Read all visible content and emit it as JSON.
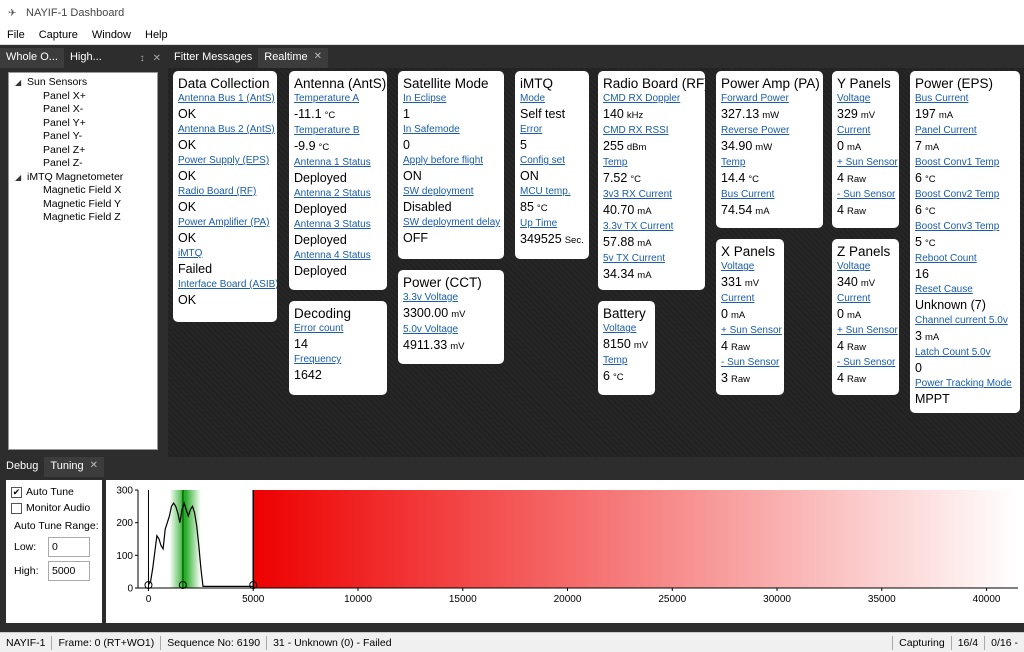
{
  "window": {
    "title": "NAYIF-1 Dashboard"
  },
  "menu": [
    "File",
    "Capture",
    "Window",
    "Help"
  ],
  "left_tabs": [
    {
      "label": "Whole O..."
    },
    {
      "label": "High..."
    }
  ],
  "tree": [
    {
      "label": "Sun Sensors",
      "level": 0,
      "expanded": true
    },
    {
      "label": "Panel X+",
      "level": 1
    },
    {
      "label": "Panel X-",
      "level": 1
    },
    {
      "label": "Panel Y+",
      "level": 1
    },
    {
      "label": "Panel Y-",
      "level": 1
    },
    {
      "label": "Panel Z+",
      "level": 1
    },
    {
      "label": "Panel Z-",
      "level": 1
    },
    {
      "label": "iMTQ Magnetometer",
      "level": 0,
      "expanded": true
    },
    {
      "label": "Magnetic Field X",
      "level": 1
    },
    {
      "label": "Magnetic Field Y",
      "level": 1
    },
    {
      "label": "Magnetic Field Z",
      "level": 1
    }
  ],
  "main_tabs": [
    {
      "label": "Fitter Messages",
      "active": false
    },
    {
      "label": "Realtime",
      "active": true
    }
  ],
  "cards": {
    "data_collection": {
      "title": "Data Collection",
      "fields": [
        {
          "label": "Antenna Bus 1 (AntS)",
          "value": "OK"
        },
        {
          "label": "Antenna Bus 2 (AntS)",
          "value": "OK"
        },
        {
          "label": "Power Supply (EPS)",
          "value": "OK"
        },
        {
          "label": "Radio Board (RF)",
          "value": "OK"
        },
        {
          "label": "Power Amplifier (PA)",
          "value": "OK"
        },
        {
          "label": "iMTQ",
          "value": "Failed"
        },
        {
          "label": "Interface Board (ASIB)",
          "value": "OK"
        }
      ]
    },
    "antenna": {
      "title": "Antenna (AntS)",
      "fields": [
        {
          "label": "Temperature A",
          "value": "-11.1",
          "unit": "°C"
        },
        {
          "label": "Temperature B",
          "value": "-9.9",
          "unit": "°C"
        },
        {
          "label": "Antenna 1 Status",
          "value": "Deployed"
        },
        {
          "label": "Antenna 2 Status",
          "value": "Deployed"
        },
        {
          "label": "Antenna 3 Status",
          "value": "Deployed"
        },
        {
          "label": "Antenna 4 Status",
          "value": "Deployed"
        }
      ]
    },
    "decoding": {
      "title": "Decoding",
      "fields": [
        {
          "label": "Error count",
          "value": "14"
        },
        {
          "label": "Frequency",
          "value": "1642"
        }
      ]
    },
    "satellite_mode": {
      "title": "Satellite Mode",
      "fields": [
        {
          "label": "In Eclipse",
          "value": "1"
        },
        {
          "label": "In Safemode",
          "value": "0"
        },
        {
          "label": "Apply before flight",
          "value": "ON"
        },
        {
          "label": "SW deployment",
          "value": "Disabled"
        },
        {
          "label": "SW deployment delay",
          "value": "OFF"
        }
      ]
    },
    "power_cct": {
      "title": "Power (CCT)",
      "fields": [
        {
          "label": "3.3v Voltage",
          "value": "3300.00",
          "unit": "mV"
        },
        {
          "label": "5.0v Voltage",
          "value": "4911.33",
          "unit": "mV"
        }
      ]
    },
    "imtq": {
      "title": "iMTQ",
      "fields": [
        {
          "label": "Mode",
          "value": "Self test"
        },
        {
          "label": "Error",
          "value": "5"
        },
        {
          "label": "Config set",
          "value": "ON"
        },
        {
          "label": "MCU temp.",
          "value": "85",
          "unit": "°C"
        },
        {
          "label": "Up Time",
          "value": "349525",
          "unit": "Sec."
        }
      ]
    },
    "radio_board": {
      "title": "Radio Board (RF)",
      "fields": [
        {
          "label": "CMD RX Doppler",
          "value": "140",
          "unit": "kHz"
        },
        {
          "label": "CMD RX RSSI",
          "value": "255",
          "unit": "dBm"
        },
        {
          "label": "Temp",
          "value": "7.52",
          "unit": "°C"
        },
        {
          "label": "3v3 RX Current",
          "value": "40.70",
          "unit": "mA"
        },
        {
          "label": "3.3v TX Current",
          "value": "57.88",
          "unit": "mA"
        },
        {
          "label": "5v TX Current",
          "value": "34.34",
          "unit": "mA"
        }
      ]
    },
    "battery": {
      "title": "Battery",
      "fields": [
        {
          "label": "Voltage",
          "value": "8150",
          "unit": "mV"
        },
        {
          "label": "Temp",
          "value": "6",
          "unit": "°C"
        }
      ]
    },
    "power_amp": {
      "title": "Power Amp (PA)",
      "fields": [
        {
          "label": "Forward Power",
          "value": "327.13",
          "unit": "mW"
        },
        {
          "label": "Reverse Power",
          "value": "34.90",
          "unit": "mW"
        },
        {
          "label": "Temp",
          "value": "14.4",
          "unit": "°C"
        },
        {
          "label": "Bus Current",
          "value": "74.54",
          "unit": "mA"
        }
      ]
    },
    "x_panels": {
      "title": "X Panels",
      "fields": [
        {
          "label": "Voltage",
          "value": "331",
          "unit": "mV"
        },
        {
          "label": "Current",
          "value": "0",
          "unit": "mA"
        },
        {
          "label": "+ Sun Sensor",
          "value": "4",
          "unit": "Raw"
        },
        {
          "label": "- Sun Sensor",
          "value": "3",
          "unit": "Raw"
        }
      ]
    },
    "y_panels": {
      "title": "Y Panels",
      "fields": [
        {
          "label": "Voltage",
          "value": "329",
          "unit": "mV"
        },
        {
          "label": "Current",
          "value": "0",
          "unit": "mA"
        },
        {
          "label": "+ Sun Sensor",
          "value": "4",
          "unit": "Raw"
        },
        {
          "label": "- Sun Sensor",
          "value": "4",
          "unit": "Raw"
        }
      ]
    },
    "z_panels": {
      "title": "Z Panels",
      "fields": [
        {
          "label": "Voltage",
          "value": "340",
          "unit": "mV"
        },
        {
          "label": "Current",
          "value": "0",
          "unit": "mA"
        },
        {
          "label": "+ Sun Sensor",
          "value": "4",
          "unit": "Raw"
        },
        {
          "label": "- Sun Sensor",
          "value": "4",
          "unit": "Raw"
        }
      ]
    },
    "power_eps": {
      "title": "Power (EPS)",
      "fields": [
        {
          "label": "Bus Current",
          "value": "197",
          "unit": "mA"
        },
        {
          "label": "Panel Current",
          "value": "7",
          "unit": "mA"
        },
        {
          "label": "Boost Conv1 Temp",
          "value": "6",
          "unit": "°C"
        },
        {
          "label": "Boost Conv2 Temp",
          "value": "6",
          "unit": "°C"
        },
        {
          "label": "Boost Conv3 Temp",
          "value": "5",
          "unit": "°C"
        },
        {
          "label": "Reboot Count",
          "value": "16"
        },
        {
          "label": "Reset Cause",
          "value": "Unknown (7)"
        },
        {
          "label": "Channel current 5.0v",
          "value": "3",
          "unit": "mA"
        },
        {
          "label": "Latch Count 5.0v",
          "value": "0"
        },
        {
          "label": "Power Tracking Mode",
          "value": "MPPT"
        }
      ]
    }
  },
  "bottom_tabs": [
    {
      "label": "Debug",
      "active": false
    },
    {
      "label": "Tuning",
      "active": true
    }
  ],
  "tuning": {
    "auto_tune_label": "Auto Tune",
    "auto_tune_checked": true,
    "monitor_audio_label": "Monitor Audio",
    "monitor_audio_checked": false,
    "range_label": "Auto Tune Range:",
    "low_label": "Low:",
    "low_value": "0",
    "high_label": "High:",
    "high_value": "5000"
  },
  "chart_data": {
    "type": "line",
    "title": "",
    "xlabel": "",
    "ylabel": "",
    "xlim": [
      -500,
      41500
    ],
    "ylim": [
      0,
      300
    ],
    "xticks": [
      0,
      5000,
      10000,
      15000,
      20000,
      25000,
      30000,
      35000,
      40000
    ],
    "yticks": [
      0,
      100,
      200,
      300
    ],
    "x": [
      0,
      100,
      200,
      300,
      400,
      500,
      600,
      700,
      800,
      900,
      1000,
      1100,
      1200,
      1300,
      1400,
      1500,
      1600,
      1700,
      1800,
      1900,
      2000,
      2100,
      2200,
      2300,
      2400,
      2500,
      2600,
      3000,
      4000,
      5000
    ],
    "y": [
      10,
      20,
      60,
      110,
      160,
      150,
      130,
      120,
      180,
      200,
      220,
      250,
      260,
      250,
      230,
      200,
      240,
      260,
      240,
      220,
      240,
      250,
      230,
      190,
      130,
      60,
      5,
      5,
      5,
      5
    ],
    "tune_low": 0,
    "tune_high": 5000,
    "signal_frequency": 1642,
    "signal_band": [
      1000,
      2500
    ],
    "colors": {
      "signal_band": "#22aa22",
      "spectrum_region": "#ee0000"
    }
  },
  "status": {
    "sat": "NAYIF-1",
    "frame": "Frame: 0 (RT+WO1)",
    "sequence": "Sequence No: 6190",
    "message": "31 - Unknown (0) - Failed",
    "state": "Capturing",
    "rate": "16/4",
    "extra": "0/16 -"
  }
}
